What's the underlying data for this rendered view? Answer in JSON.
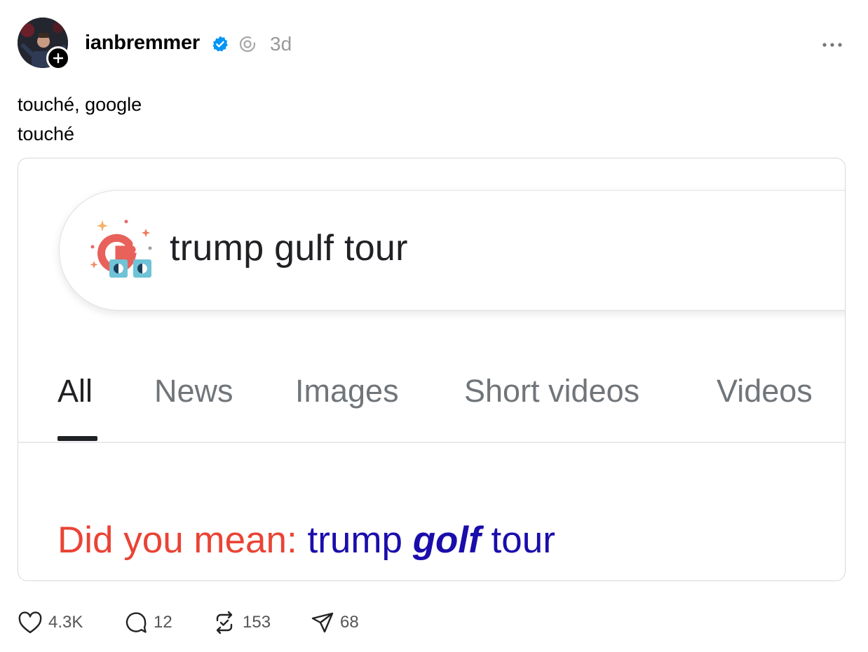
{
  "post": {
    "username": "ianbremmer",
    "time": "3d",
    "text_lines": [
      "touché, google",
      "touché"
    ]
  },
  "screenshot": {
    "query": "trump gulf tour",
    "tabs": [
      "All",
      "News",
      "Images",
      "Short videos",
      "Videos"
    ],
    "active_tab": "All",
    "did_you_mean_label": "Did you mean:",
    "suggestion_pre": "trump",
    "suggestion_emph": "golf",
    "suggestion_post": "tour"
  },
  "actions": {
    "likes": "4.3K",
    "replies": "12",
    "reposts": "153",
    "shares": "68"
  },
  "colors": {
    "verified": "#0095f6",
    "suggestion_red": "#ea4335",
    "suggestion_blue": "#1a0dab"
  },
  "icons": [
    "avatar",
    "follow-plus-icon",
    "verified-badge-icon",
    "threads-icon",
    "more-options-icon",
    "google-doodle-icon",
    "heart-icon",
    "reply-icon",
    "repost-icon",
    "share-icon"
  ]
}
